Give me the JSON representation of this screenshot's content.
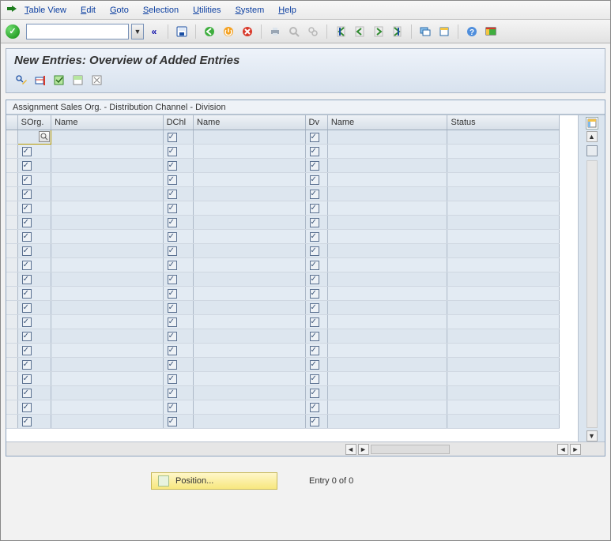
{
  "menubar": {
    "items": [
      {
        "label": "Table View",
        "u": 0
      },
      {
        "label": "Edit",
        "u": 0
      },
      {
        "label": "Goto",
        "u": 0
      },
      {
        "label": "Selection",
        "u": 0
      },
      {
        "label": "Utilities",
        "u": 0
      },
      {
        "label": "System",
        "u": 0
      },
      {
        "label": "Help",
        "u": 0
      }
    ]
  },
  "toolbar": {
    "command_value": ""
  },
  "title": "New Entries: Overview of Added Entries",
  "frame_title": "Assignment Sales Org. - Distribution Channel - Division",
  "columns": {
    "sorg": "SOrg.",
    "name1": "Name",
    "dchl": "DChl",
    "name2": "Name",
    "dv": "Dv",
    "name3": "Name",
    "status": "Status"
  },
  "row_count": 21,
  "footer": {
    "position_label": "Position...",
    "entry_text": "Entry 0 of 0"
  }
}
